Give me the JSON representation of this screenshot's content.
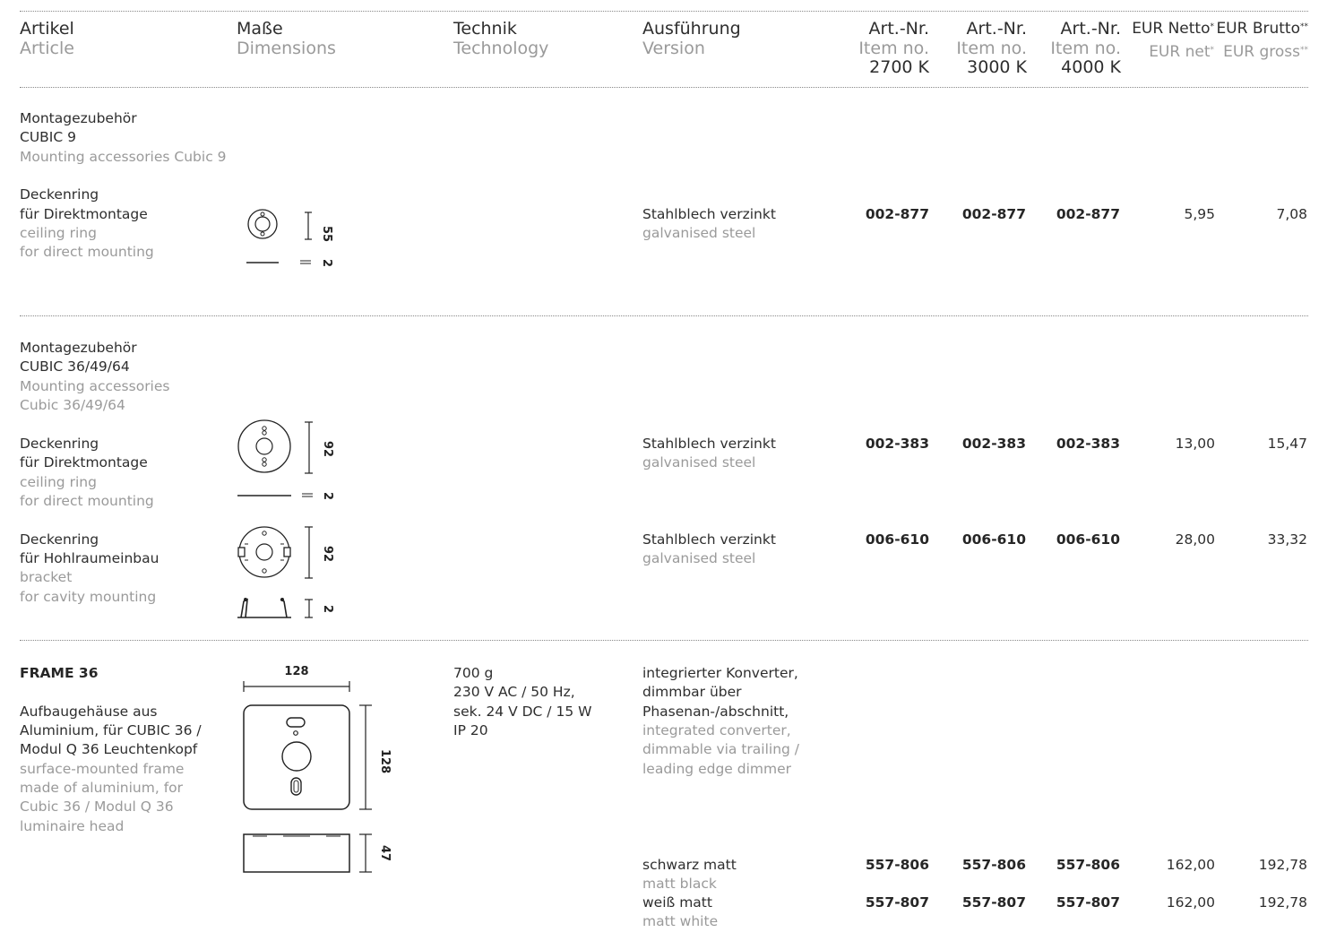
{
  "header": {
    "artikel_de": "Artikel",
    "artikel_en": "Article",
    "masse_de": "Maße",
    "masse_en": "Dimensions",
    "technik_de": "Technik",
    "technik_en": "Technology",
    "ausf_de": "Ausführung",
    "ausf_en": "Version",
    "artnr1_de": "Art.-Nr.",
    "artnr1_en": "Item no.",
    "artnr1_k": "2700 K",
    "artnr2_de": "Art.-Nr.",
    "artnr2_en": "Item no.",
    "artnr2_k": "3000 K",
    "artnr3_de": "Art.-Nr.",
    "artnr3_en": "Item no.",
    "artnr3_k": "4000 K",
    "netto_de": "EUR Netto",
    "netto_en": "EUR net",
    "star1": "*",
    "brutto_de": "EUR Brutto",
    "brutto_en": "EUR gross",
    "star2": "**"
  },
  "section1": {
    "title_de_1": "Montagezubehör",
    "title_de_2": "CUBIC 9",
    "title_en": "Mounting accessories Cubic 9",
    "item": {
      "de_1": "Deckenring",
      "de_2": "für Direktmontage",
      "en_1": "ceiling ring",
      "en_2": "for direct mounting",
      "dim_h": "55",
      "dim_t": "2",
      "ausf_de": "Stahlblech verzinkt",
      "ausf_en": "galvanised steel",
      "art1": "002-877",
      "art2": "002-877",
      "art3": "002-877",
      "netto": "5,95",
      "brutto": "7,08"
    }
  },
  "section2": {
    "title_de_1": "Montagezubehör",
    "title_de_2": "CUBIC 36/49/64",
    "title_en_1": "Mounting accessories",
    "title_en_2": "Cubic 36/49/64",
    "item1": {
      "de_1": "Deckenring",
      "de_2": "für Direktmontage",
      "en_1": "ceiling ring",
      "en_2": "for direct mounting",
      "dim_h": "92",
      "dim_t": "2",
      "ausf_de": "Stahlblech verzinkt",
      "ausf_en": "galvanised steel",
      "art1": "002-383",
      "art2": "002-383",
      "art3": "002-383",
      "netto": "13,00",
      "brutto": "15,47"
    },
    "item2": {
      "de_1": "Deckenring",
      "de_2": "für Hohlraumeinbau",
      "en_1": "bracket",
      "en_2": "for cavity mounting",
      "dim_h": "92",
      "dim_t": "2",
      "ausf_de": "Stahlblech verzinkt",
      "ausf_en": "galvanised steel",
      "art1": "006-610",
      "art2": "006-610",
      "art3": "006-610",
      "netto": "28,00",
      "brutto": "33,32"
    }
  },
  "section3": {
    "title": "FRAME 36",
    "desc_de_1": "Aufbaugehäuse aus",
    "desc_de_2": "Aluminium, für CUBIC 36 /",
    "desc_de_3": "Modul Q 36 Leuchtenkopf",
    "desc_en_1": "surface-mounted frame",
    "desc_en_2": "made of aluminium, for",
    "desc_en_3": "Cubic 36 / Modul Q 36",
    "desc_en_4": "luminaire head",
    "dim_w": "128",
    "dim_h": "128",
    "dim_d": "47",
    "tech_1": "700 g",
    "tech_2": "230 V AC / 50 Hz,",
    "tech_3": "sek. 24 V DC / 15 W",
    "tech_4": "IP 20",
    "ausf_de_1": "integrierter Konverter,",
    "ausf_de_2": "dimmbar über",
    "ausf_de_3": "Phasenan-/abschnitt,",
    "ausf_en_1": "integrated converter,",
    "ausf_en_2": "dimmable via trailing /",
    "ausf_en_3": "leading edge dimmer",
    "var1": {
      "de": "schwarz matt",
      "en": "matt black",
      "art1": "557-806",
      "art2": "557-806",
      "art3": "557-806",
      "netto": "162,00",
      "brutto": "192,78"
    },
    "var2": {
      "de": "weiß matt",
      "en": "matt white",
      "art1": "557-807",
      "art2": "557-807",
      "art3": "557-807",
      "netto": "162,00",
      "brutto": "192,78"
    }
  }
}
